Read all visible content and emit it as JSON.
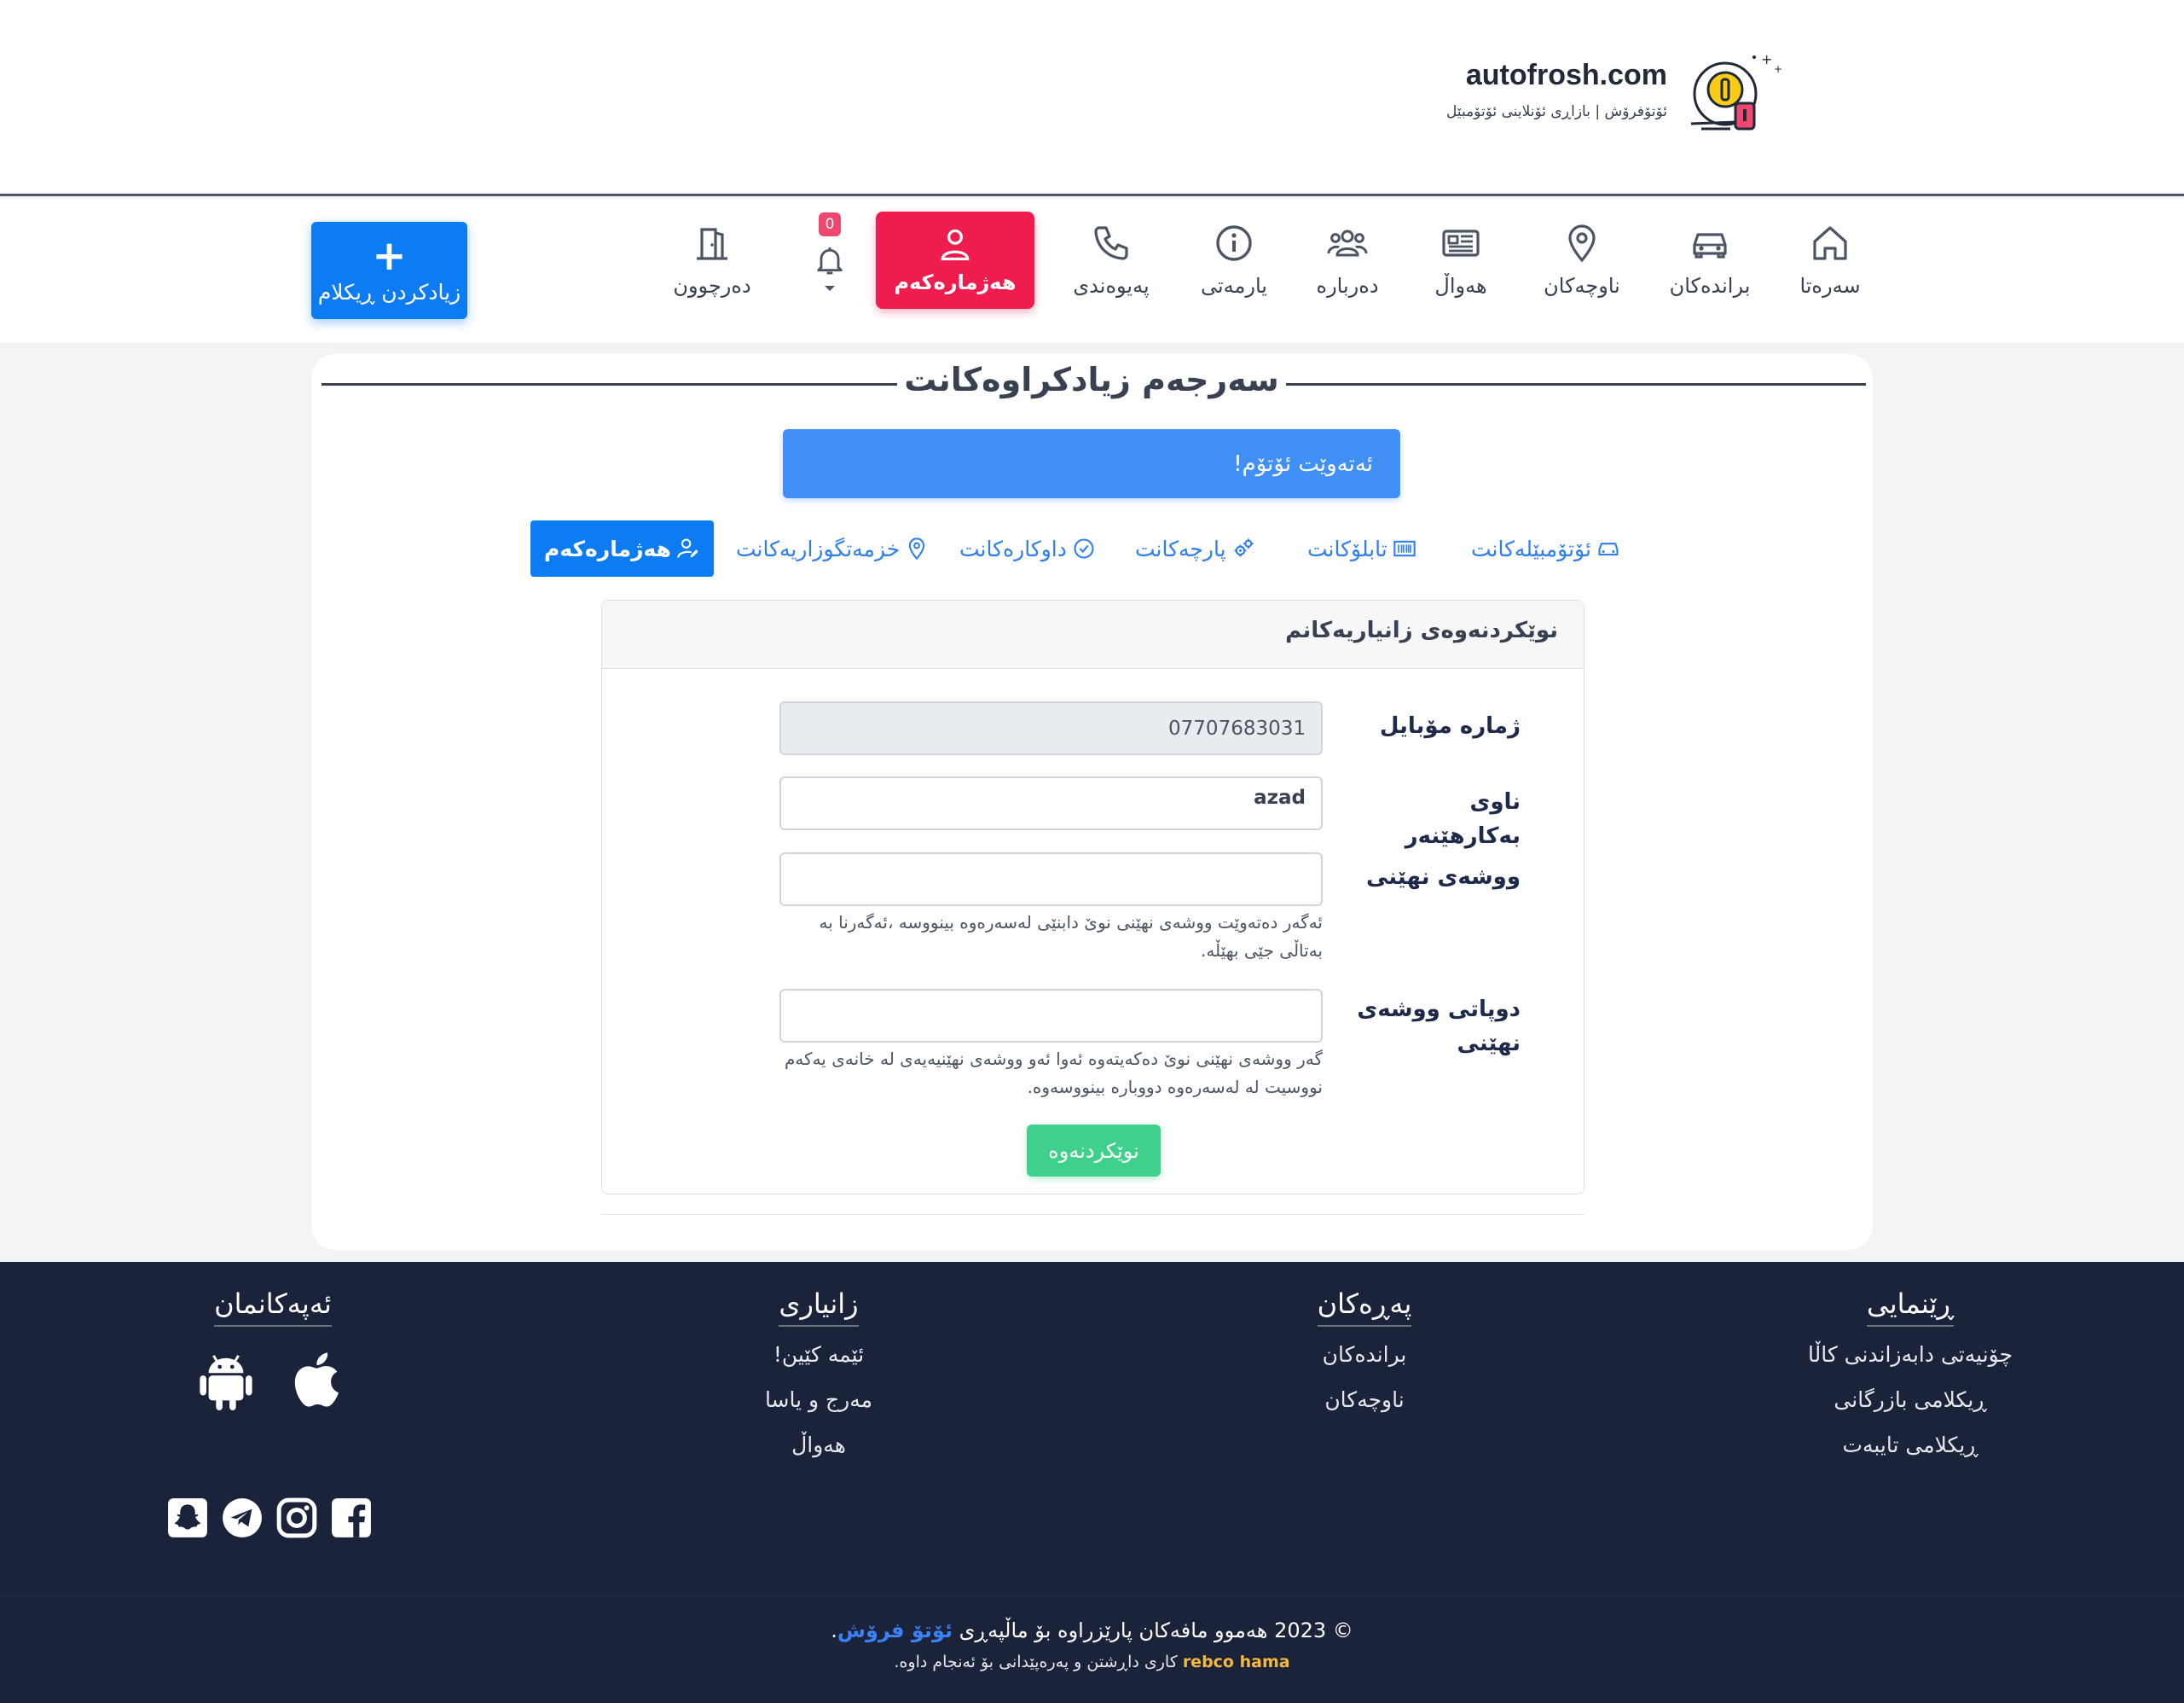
{
  "header": {
    "logo_text": "autofrosh.com",
    "logo_subtitle": "ئۆتۆفرۆش | بازاڕی ئۆنلاینی ئۆتۆمبێل"
  },
  "nav": {
    "items": [
      {
        "label": "سەرەتا",
        "icon": "home-icon"
      },
      {
        "label": "براندەکان",
        "icon": "car-icon"
      },
      {
        "label": "ناوچەکان",
        "icon": "map-pin-icon"
      },
      {
        "label": "هەواڵ",
        "icon": "newspaper-icon"
      },
      {
        "label": "دەربارە",
        "icon": "users-icon"
      },
      {
        "label": "یارمەتی",
        "icon": "info-icon"
      },
      {
        "label": "پەیوەندی",
        "icon": "phone-icon"
      }
    ],
    "account_label": "هەژمارەکەم",
    "notification_count": "0",
    "logout_label": "دەرچوون",
    "add_ad_plus": "+",
    "add_ad_label": "زیادکردن ڕیکلام"
  },
  "main": {
    "title": "سەرجەم زیادکراوەکانت",
    "welcome": "ئەتەوێت ئۆتۆم!",
    "tabs": [
      {
        "label": "ئۆتۆمبێلەکانت",
        "icon": "car-icon"
      },
      {
        "label": "تابلۆکانت",
        "icon": "barcode-icon"
      },
      {
        "label": "پارچەکانت",
        "icon": "gears-icon"
      },
      {
        "label": "داوکارەکانت",
        "icon": "check-badge-icon"
      },
      {
        "label": "خزمەتگوزاریەکانت",
        "icon": "map-pin-icon"
      },
      {
        "label": "هەژمارەکەم",
        "icon": "user-edit-icon"
      }
    ],
    "form": {
      "title": "نوێکردنەوەی زانیاریەکانم",
      "mobile_label": "ژمارە مۆبایل",
      "mobile_value": "07707683031",
      "username_label": "ناوی بەکارهێنەر",
      "username_value": "azad",
      "password_label": "ووشەی نهێنی",
      "password_help": "ئەگەر دەتەوێت ووشەی نهێنی نوێ دابنێی لەسەرەوە بینووسە ،ئەگەرنا بە بەتاڵی جێی بهێڵە.",
      "confirm_label": "دوپاتی ووشەی نهێنی",
      "confirm_help": "گەر ووشەی نهێنی نوێ دەکەیتەوە ئەوا ئەو ووشەی نهێنیەیەی لە خانەی یەکەم نووسیت لە لەسەرەوە دووبارە بینووسەوە.",
      "submit_label": "نوێکردنەوە"
    }
  },
  "footer": {
    "guide": {
      "title": "ڕێنمایی",
      "links": [
        "چۆنیەتی دابەزاندنی کاڵا",
        "ڕیکلامی بازرگانی",
        "ڕیکلامی تایبەت"
      ]
    },
    "pages": {
      "title": "پەڕەکان",
      "links": [
        "براندەکان",
        "ناوچەکان"
      ]
    },
    "info": {
      "title": "زانیاری",
      "links": [
        "ئێمە کێین!",
        "مەرج و یاسا",
        "هەواڵ"
      ]
    },
    "apps": {
      "title": "ئەپەکانمان"
    },
    "copyright_prefix": "© 2023 هەموو مافەکان پارێزراوە بۆ ماڵپەڕی",
    "copyright_brand": "ئۆتۆ فرۆش",
    "copyright_suffix": ".",
    "dev_name": "rebco hama",
    "dev_text": "کاری داڕشتن و پەرەپێدانی بۆ ئەنجام داوە."
  }
}
